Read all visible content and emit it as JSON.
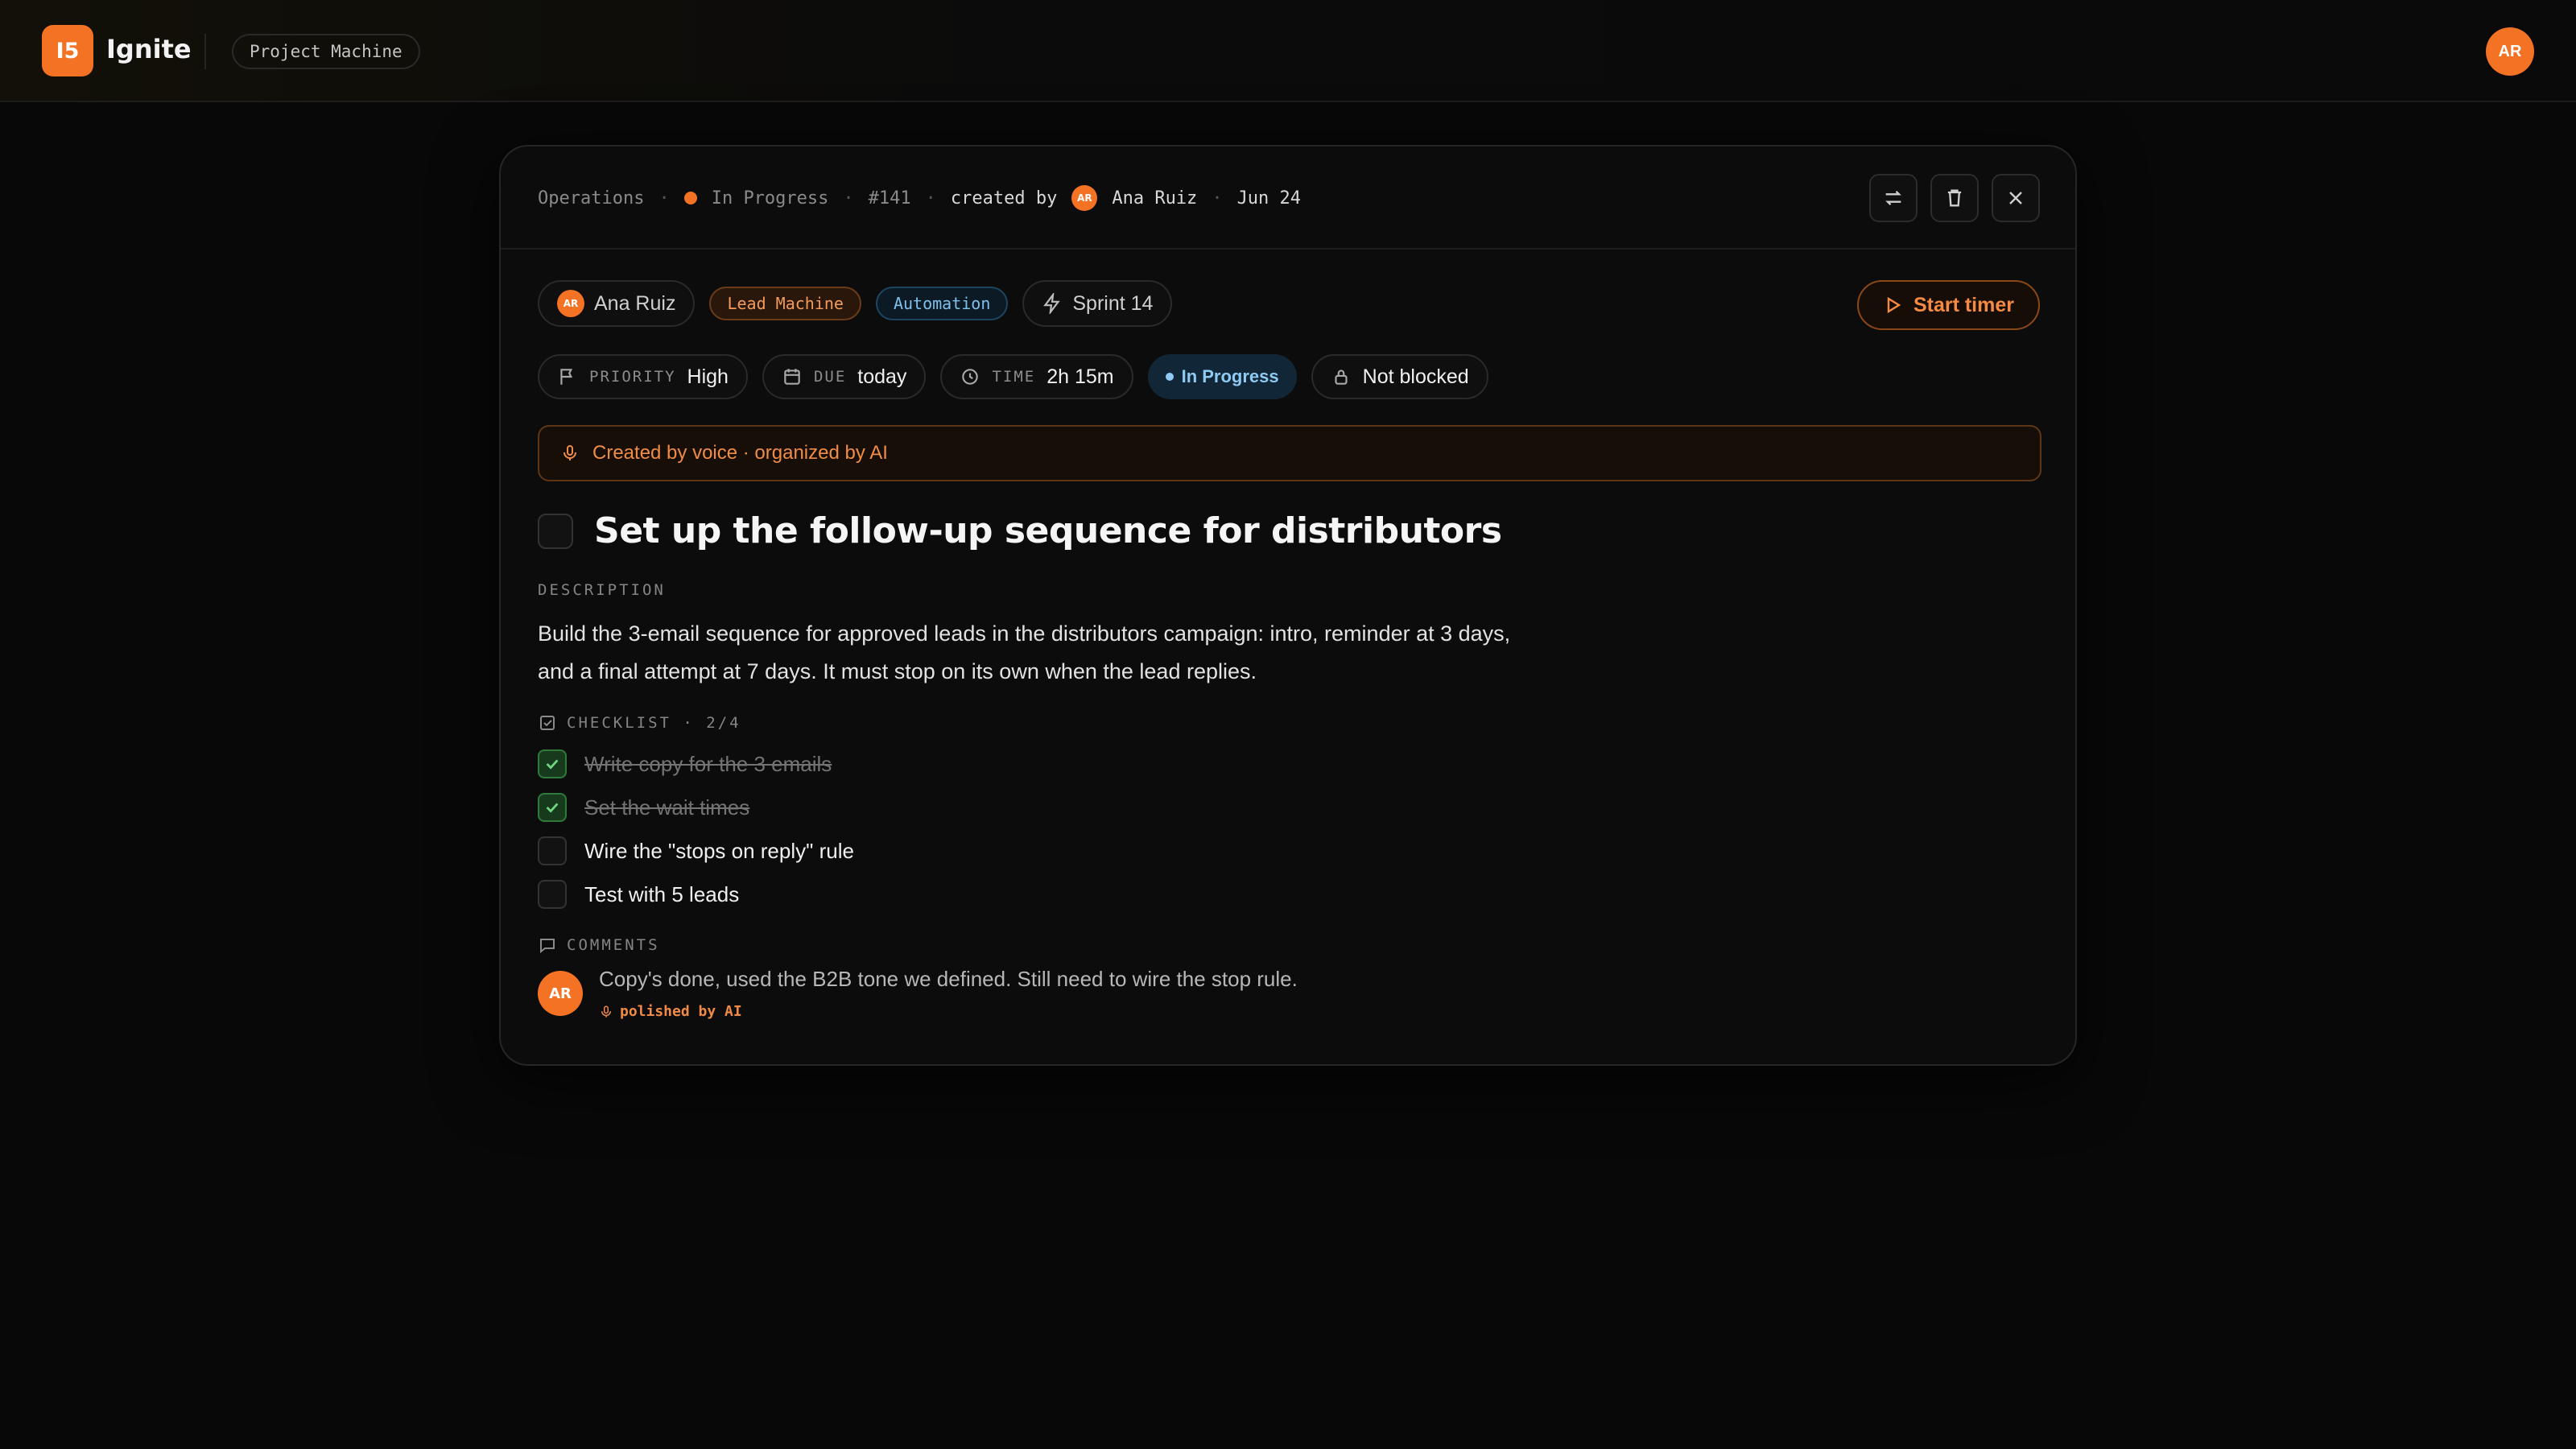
{
  "app": {
    "logo_text": "I5",
    "name": "Ignite",
    "project": "Project Machine",
    "user_initials": "AR"
  },
  "task": {
    "meta": {
      "area": "Operations",
      "status": "In Progress",
      "id": "#141",
      "created_by_label": "created by",
      "creator_initials": "AR",
      "creator": "Ana Ruiz",
      "date": "Jun 24",
      "separator": "·"
    },
    "header_icons": [
      "swap-icon",
      "trash-icon",
      "close-icon"
    ],
    "assignee": {
      "initials": "AR",
      "name": "Ana Ruiz"
    },
    "tags": [
      "Lead Machine",
      "Automation"
    ],
    "sprint": "Sprint 14",
    "start_timer_label": "Start timer",
    "props": {
      "priority_label": "PRIORITY",
      "priority_value": "High",
      "due_label": "DUE",
      "due_value": "today",
      "time_label": "TIME",
      "time_value": "2h 15m",
      "status": "In Progress",
      "blocked": "Not blocked"
    },
    "banner": "Created by voice · organized by AI",
    "title": "Set up the follow-up sequence for distributors",
    "description_label": "DESCRIPTION",
    "description": "Build the 3-email sequence for approved leads in the distributors campaign: intro, reminder at 3 days, and a final attempt at 7 days. It must stop on its own when the lead replies.",
    "checklist_label": "CHECKLIST · 2/4",
    "checklist": [
      {
        "text": "Write copy for the 3 emails",
        "done": true
      },
      {
        "text": "Set the wait times",
        "done": true
      },
      {
        "text": "Wire the \"stops on reply\" rule",
        "done": false
      },
      {
        "text": "Test with 5 leads",
        "done": false
      }
    ],
    "comments_label": "COMMENTS",
    "comment": {
      "initials": "AR",
      "text": "Copy's done, used the B2B tone we defined. Still need to wire the stop rule.",
      "ai_note": "polished by AI"
    }
  },
  "colors": {
    "accent": "#f37224",
    "status_blue": "#8fcaf2",
    "done_green": "#6fd67f"
  }
}
